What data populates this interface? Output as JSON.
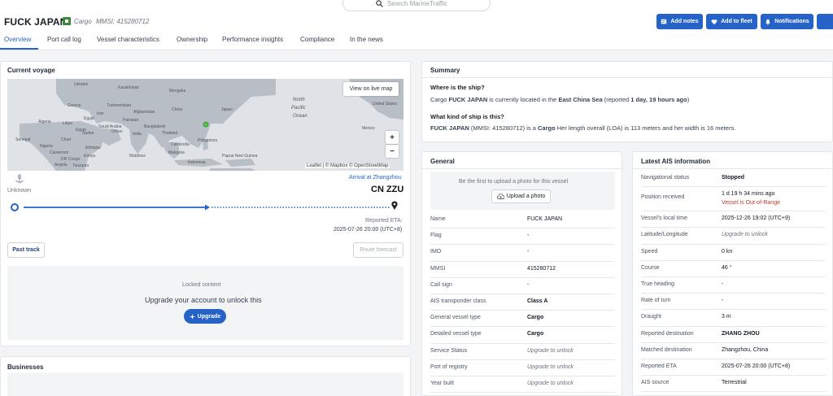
{
  "header": {
    "vessel_name": "FUCK JAPAN",
    "vessel_type": "Cargo",
    "mmsi_label": "MMSI: 415280712",
    "search_placeholder": "Search MarineTraffic",
    "buttons": {
      "add_notes": "Add notes",
      "add_to_fleet": "Add to fleet",
      "notifications": "Notifications"
    },
    "flag_color": "#3a8a3a",
    "accent": "#2563c9"
  },
  "tabs": [
    "Overview",
    "Port call log",
    "Vessel characteristics",
    "Ownership",
    "Performance insights",
    "Compliance",
    "In the news"
  ],
  "voyage": {
    "title": "Current voyage",
    "view_live_map": "View on live map",
    "zoom_in": "+",
    "zoom_out": "−",
    "attribution": "Leaflet | © Mapbox © OpenStreetMap",
    "map_labels": [
      "Ukraine",
      "Kazakhstan",
      "Mongolia",
      "Iran",
      "China",
      "Japan",
      "North",
      "Pacific",
      "Ocean",
      "United States",
      "Mexico",
      "India",
      "Bangladesh",
      "Thailand",
      "Cambodia",
      "Philippines",
      "Malaysia",
      "Indonesia",
      "Papua New Guinea",
      "Ethiopia",
      "Kenya",
      "Tanzania",
      "Angola",
      "Algeria",
      "Libya",
      "Egypt",
      "Senegal",
      "Cameroon",
      "Oman",
      "Pakistan",
      "Maldives",
      "Sudan",
      "Afghanistan",
      "Greece",
      "Turkmenistan",
      "Saudi Arabia",
      "Egypt",
      "Nigeria",
      "DR Congo",
      "Chad"
    ],
    "origin": "Unknown",
    "arrival_label": "Arrival at Zhangzhou",
    "destination_code": "CN ZZU",
    "eta_label": "Reported ETA:",
    "eta_value": "2025-07-26 20:00 (UTC+8)",
    "past_track": "Past track",
    "route_forecast": "Route forecast",
    "locked_title": "Locked content",
    "locked_text": "Upgrade your account to unlock this",
    "upgrade": "Upgrade"
  },
  "businesses": {
    "title": "Businesses"
  },
  "summary": {
    "title": "Summary",
    "q1": "Where is the ship?",
    "a1_pre": "Cargo ",
    "a1_name": "FUCK JAPAN",
    "a1_mid": " is currently located in the ",
    "a1_place": "East China Sea",
    "a1_rep": " (reported ",
    "a1_time": "1 day, 19 hours ago",
    "a1_end": ")",
    "q2": "What kind of ship is this?",
    "a2_name": "FUCK JAPAN",
    "a2_mid": " (MMSI: 415280712) is a ",
    "a2_type": "Cargo",
    "a2_end": " Her length overall (LOA) is 113 meters and her width is 16 meters."
  },
  "general": {
    "title": "General",
    "photo_text": "Be the first to upload a photo for this vessel",
    "upload": "Upload a photo",
    "rows": [
      {
        "label": "Name",
        "value": "FUCK JAPAN",
        "style": "normal"
      },
      {
        "label": "Flag",
        "value": "-",
        "style": "normal"
      },
      {
        "label": "IMO",
        "value": "-",
        "style": "normal"
      },
      {
        "label": "MMSI",
        "value": "415280712",
        "style": "normal"
      },
      {
        "label": "Call sign",
        "value": "-",
        "style": "normal"
      },
      {
        "label": "AIS transponder class",
        "value": "Class A",
        "style": "bold"
      },
      {
        "label": "General vessel type",
        "value": "Cargo",
        "style": "bold"
      },
      {
        "label": "Detailed vessel type",
        "value": "Cargo",
        "style": "bold"
      },
      {
        "label": "Service Status",
        "value": "Upgrade to unlock",
        "style": "italic"
      },
      {
        "label": "Port of registry",
        "value": "Upgrade to unlock",
        "style": "italic"
      },
      {
        "label": "Year built",
        "value": "Upgrade to unlock",
        "style": "italic"
      }
    ]
  },
  "ais": {
    "title": "Latest AIS information",
    "rows": [
      {
        "label": "Navigational status",
        "value": "Stopped",
        "style": "bold"
      },
      {
        "label": "Position received",
        "value": "1 d 19 h 34 mins ago",
        "value2": "Vessel is Out-of-Range",
        "style": "normal"
      },
      {
        "label": "Vessel's local time",
        "value": "2025-12-26 19:02 (UTC+9)",
        "style": "normal"
      },
      {
        "label": "Latitude/Longitude",
        "value": "Upgrade to unlock",
        "style": "italic"
      },
      {
        "label": "Speed",
        "value": "0 kn",
        "style": "normal"
      },
      {
        "label": "Course",
        "value": "46 °",
        "style": "normal"
      },
      {
        "label": "True heading",
        "value": "-",
        "style": "normal"
      },
      {
        "label": "Rate of turn",
        "value": "-",
        "style": "normal"
      },
      {
        "label": "Draught",
        "value": "3 m",
        "style": "normal"
      },
      {
        "label": "Reported destination",
        "value": "ZHANG ZHOU",
        "style": "bold"
      },
      {
        "label": "Matched destination",
        "value": "Zhangzhou, China",
        "style": "normal"
      },
      {
        "label": "Reported ETA",
        "value": "2025-07-26 20:00 (UTC+8)",
        "style": "normal"
      },
      {
        "label": "AIS source",
        "value": "Terrestrial",
        "style": "normal"
      }
    ]
  }
}
